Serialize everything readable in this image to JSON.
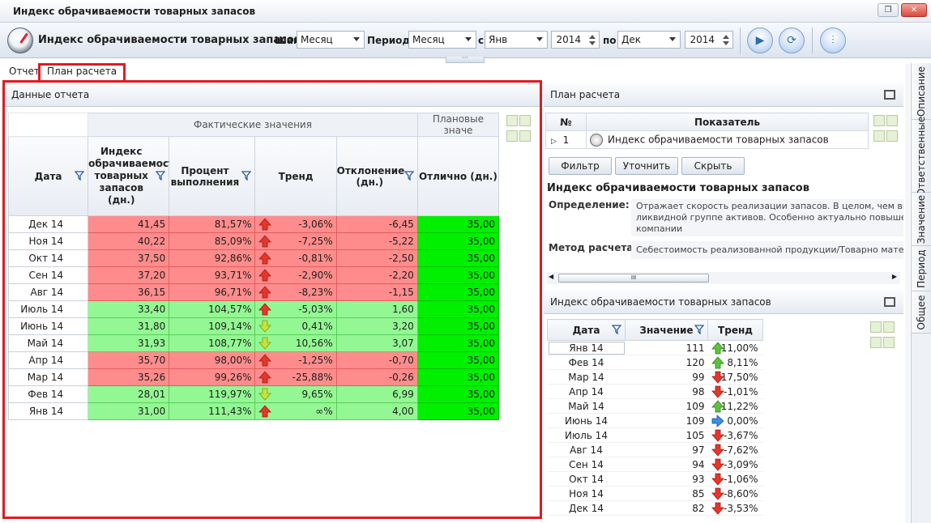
{
  "window": {
    "title": "Индекс обрачиваемости товарных запасов"
  },
  "toolbar": {
    "app_title": "Индекс обрачиваемости товарных запасов",
    "step_label": "Шаг:",
    "step_value": "Месяц",
    "period_label": "Период:",
    "period_value": "Месяц",
    "from_label": "с",
    "from_month": "Янв",
    "from_year": "2014",
    "to_label": "по",
    "to_month": "Дек",
    "to_year": "2014"
  },
  "tabs": [
    {
      "label": "Отчет"
    },
    {
      "label": "План расчета"
    }
  ],
  "report": {
    "panel_title": "Данные отчета",
    "group_actual": "Фактические значения",
    "group_plan": "Плановые значе",
    "columns": {
      "date": "Дата",
      "index": "Индекс обрачиваемости товарных запасов (дн.)",
      "percent": "Процент выполнения",
      "trend": "Тренд",
      "deviation": "Отклонение (дн.)",
      "excellent": "Отлично (дн.)"
    },
    "rows": [
      {
        "date": "Дек 14",
        "index": "41,45",
        "percent": "81,57%",
        "trend": "-3,06%",
        "dev": "-6,45",
        "exc": "35,00",
        "state": "red",
        "dir": "up-red"
      },
      {
        "date": "Ноя 14",
        "index": "40,22",
        "percent": "85,09%",
        "trend": "-7,25%",
        "dev": "-5,22",
        "exc": "35,00",
        "state": "red",
        "dir": "up-red"
      },
      {
        "date": "Окт 14",
        "index": "37,50",
        "percent": "92,86%",
        "trend": "-0,81%",
        "dev": "-2,50",
        "exc": "35,00",
        "state": "red",
        "dir": "up-red"
      },
      {
        "date": "Сен 14",
        "index": "37,20",
        "percent": "93,71%",
        "trend": "-2,90%",
        "dev": "-2,20",
        "exc": "35,00",
        "state": "red",
        "dir": "up-red"
      },
      {
        "date": "Авг 14",
        "index": "36,15",
        "percent": "96,71%",
        "trend": "-8,23%",
        "dev": "-1,15",
        "exc": "35,00",
        "state": "red",
        "dir": "up-red"
      },
      {
        "date": "Июль 14",
        "index": "33,40",
        "percent": "104,57%",
        "trend": "-5,03%",
        "dev": "1,60",
        "exc": "35,00",
        "state": "green",
        "dir": "up-red"
      },
      {
        "date": "Июнь 14",
        "index": "31,80",
        "percent": "109,14%",
        "trend": "0,41%",
        "dev": "3,20",
        "exc": "35,00",
        "state": "green",
        "dir": "down-yellow"
      },
      {
        "date": "Май 14",
        "index": "31,93",
        "percent": "108,77%",
        "trend": "10,56%",
        "dev": "3,07",
        "exc": "35,00",
        "state": "green",
        "dir": "down-yellow"
      },
      {
        "date": "Апр 14",
        "index": "35,70",
        "percent": "98,00%",
        "trend": "-1,25%",
        "dev": "-0,70",
        "exc": "35,00",
        "state": "red",
        "dir": "up-red"
      },
      {
        "date": "Мар 14",
        "index": "35,26",
        "percent": "99,26%",
        "trend": "-25,88%",
        "dev": "-0,26",
        "exc": "35,00",
        "state": "red",
        "dir": "up-red"
      },
      {
        "date": "Фев 14",
        "index": "28,01",
        "percent": "119,97%",
        "trend": "9,65%",
        "dev": "6,99",
        "exc": "35,00",
        "state": "green",
        "dir": "down-yellow"
      },
      {
        "date": "Янв 14",
        "index": "31,00",
        "percent": "111,43%",
        "trend": "∞%",
        "dev": "4,00",
        "exc": "35,00",
        "state": "green",
        "dir": "up-red"
      }
    ]
  },
  "plan": {
    "panel_title": "План расчета",
    "col_no": "№",
    "col_indicator": "Показатель",
    "row_no": "1",
    "row_indicator": "Индекс обрачиваемости товарных запасов",
    "btn_filter": "Фильтр",
    "btn_refine": "Уточнить",
    "btn_hide": "Скрыть",
    "def_title": "Индекс обрачиваемости товарных запасов",
    "def_label": "Определение:",
    "def_line1": "Отражает скорость реализации запасов. В целом, чем выш",
    "def_line2": "ликвидной группе активов. Особенно актуально повышени",
    "def_line3": "компании",
    "method_label": "Метод расчета:",
    "method_text": "Себестоимость реализованной продукции/Товарно матери"
  },
  "index": {
    "panel_title": "Индекс обрачиваемости товарных запасов",
    "col_date": "Дата",
    "col_value": "Значение",
    "col_trend": "Тренд",
    "rows": [
      {
        "date": "Янв 14",
        "value": "111",
        "trend": "11,00%",
        "dir": "up-green"
      },
      {
        "date": "Фев 14",
        "value": "120",
        "trend": "8,11%",
        "dir": "up-green"
      },
      {
        "date": "Мар 14",
        "value": "99",
        "trend": "-17,50%",
        "dir": "down-red"
      },
      {
        "date": "Апр 14",
        "value": "98",
        "trend": "-1,01%",
        "dir": "down-red"
      },
      {
        "date": "Май 14",
        "value": "109",
        "trend": "11,22%",
        "dir": "up-green"
      },
      {
        "date": "Июнь 14",
        "value": "109",
        "trend": "0,00%",
        "dir": "right-blue"
      },
      {
        "date": "Июль 14",
        "value": "105",
        "trend": "-3,67%",
        "dir": "down-red"
      },
      {
        "date": "Авг 14",
        "value": "97",
        "trend": "-7,62%",
        "dir": "down-red"
      },
      {
        "date": "Сен 14",
        "value": "94",
        "trend": "-3,09%",
        "dir": "down-red"
      },
      {
        "date": "Окт 14",
        "value": "93",
        "trend": "-1,06%",
        "dir": "down-red"
      },
      {
        "date": "Ноя 14",
        "value": "85",
        "trend": "-8,60%",
        "dir": "down-red"
      },
      {
        "date": "Дек 14",
        "value": "82",
        "trend": "-3,53%",
        "dir": "down-red"
      }
    ]
  },
  "side_tabs": [
    "Описание",
    "Ответственные",
    "Значение",
    "Период",
    "Общее"
  ],
  "colors": {
    "red_cell": "#ff8c8c",
    "green_cell": "#93f893",
    "bright_green": "#00f000",
    "highlight": "#e01a22"
  }
}
